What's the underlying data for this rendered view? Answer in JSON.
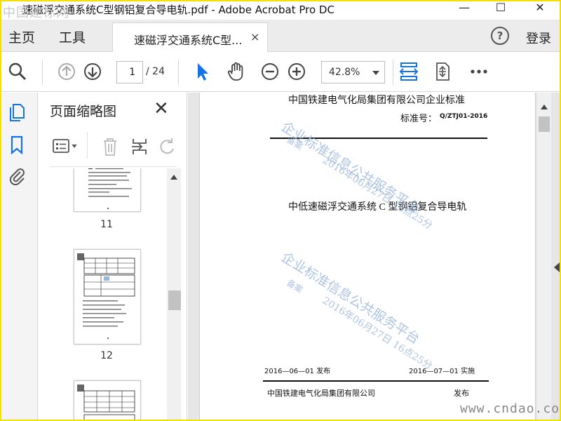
{
  "window": {
    "watermark_top": "中国建标网",
    "title": "速磁浮交通系统C型钢铝复合导电轨.pdf - Adobe Acrobat Pro DC",
    "minimize": "—",
    "maximize": "☐",
    "close": "✕"
  },
  "tabbar": {
    "home": "主页",
    "tools": "工具",
    "doc_tab_label": "速磁浮交通系统C型...",
    "doc_tab_close": "×",
    "help": "?",
    "login": "登录"
  },
  "toolbar": {
    "current_page": "1",
    "page_total": "/ 24",
    "zoom": "42.8%",
    "icons": [
      "search-icon",
      "page-up-icon",
      "page-down-icon",
      "select-cursor-icon",
      "hand-icon",
      "zoom-out-icon",
      "zoom-in-icon",
      "fit-width-icon",
      "fit-page-icon",
      "more-icon"
    ]
  },
  "thumbnails_panel": {
    "title": "页面缩略图",
    "close": "✕",
    "thumbs": [
      {
        "label": "11"
      },
      {
        "label": "12"
      },
      {
        "label": ""
      }
    ]
  },
  "document": {
    "company_standard": "中国铁建电气化局集团有限公司企业标准",
    "standard_no_label": "标准号：",
    "standard_no": "Q/ZTJ01-2016",
    "doc_title": "中低速磁浮交通系统 C 型钢铝复合导电轨",
    "publish_date": "2016—06—01 发布",
    "implement_date": "2016—07—01  实施",
    "publisher": "中国铁建电气化局集团有限公司",
    "publish_word": "发布",
    "stamp_line1": "企业标准信息公共服务平台",
    "stamp_line2": "备案",
    "stamp_line3": "2016年06月27日  16点25分"
  },
  "site_watermark": "www.cndao.com",
  "colors": {
    "border": "#f2e000",
    "accent": "#1473e6",
    "stamp": "#9bb6dd"
  }
}
